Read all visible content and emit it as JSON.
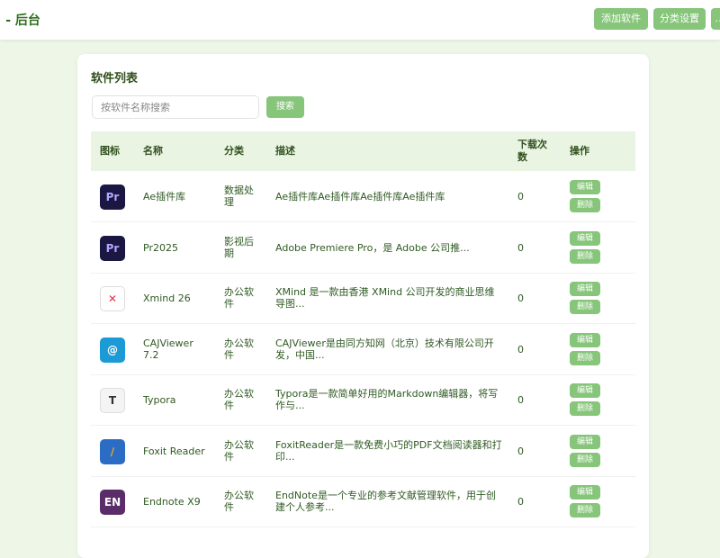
{
  "header": {
    "title": "· - 后台",
    "add_button": "添加软件",
    "category_button": "分类设置",
    "third_button": "…"
  },
  "card": {
    "title": "软件列表",
    "search_placeholder": "按软件名称搜索",
    "search_button": "搜索"
  },
  "table": {
    "headers": {
      "icon": "图标",
      "name": "名称",
      "category": "分类",
      "description": "描述",
      "downloads_line1": "下载次",
      "downloads_line2": "数",
      "actions": "操作"
    },
    "edit_label": "编辑",
    "delete_label": "删除",
    "rows": [
      {
        "icon": "premiere-icon",
        "icon_text": "Pr",
        "icon_bg": "#1a1742",
        "icon_fg": "#b4a7ff",
        "name1": "Ae插件库",
        "name2": "",
        "cat1": "数据处",
        "cat2": "理",
        "desc1": "Ae插件库Ae插件库Ae插件库Ae插件库",
        "desc2": "",
        "downloads": "0"
      },
      {
        "icon": "premiere-icon",
        "icon_text": "Pr",
        "icon_bg": "#1a1742",
        "icon_fg": "#b4a7ff",
        "name1": "Pr2025",
        "name2": "",
        "cat1": "影视后",
        "cat2": "期",
        "desc1": "Adobe Premiere Pro，是 Adobe 公司推...",
        "desc2": "",
        "downloads": "0"
      },
      {
        "icon": "xmind-icon",
        "icon_text": "✕",
        "icon_bg": "#ffffff",
        "icon_fg": "#e0324a",
        "name1": "Xmind 26",
        "name2": "",
        "cat1": "办公软",
        "cat2": "件",
        "desc1": "XMind 是一款由香港 XMind 公司开发的商业思维",
        "desc2": "导图...",
        "downloads": "0"
      },
      {
        "icon": "cajviewer-icon",
        "icon_text": "@",
        "icon_bg": "#1c9ad6",
        "icon_fg": "#ffffff",
        "name1": "CAJViewer",
        "name2": "7.2",
        "cat1": "办公软",
        "cat2": "件",
        "desc1": "CAJViewer是由同方知网（北京）技术有限公司开",
        "desc2": "发，中国...",
        "downloads": "0"
      },
      {
        "icon": "typora-icon",
        "icon_text": "T",
        "icon_bg": "#f4f4f4",
        "icon_fg": "#333333",
        "name1": "Typora",
        "name2": "",
        "cat1": "办公软",
        "cat2": "件",
        "desc1": "Typora是一款简单好用的Markdown编辑器，将写",
        "desc2": "作与...",
        "downloads": "0"
      },
      {
        "icon": "foxit-reader-icon",
        "icon_text": "∕",
        "icon_bg": "#2b6cc4",
        "icon_fg": "#f5a623",
        "name1": "Foxit Reader",
        "name2": "",
        "cat1": "办公软",
        "cat2": "件",
        "desc1": "FoxitReader是一款免费小巧的PDF文档阅读器和打",
        "desc2": "印...",
        "downloads": "0"
      },
      {
        "icon": "endnote-icon",
        "icon_text": "EN",
        "icon_bg": "#5a2d6a",
        "icon_fg": "#ffffff",
        "name1": "Endnote X9",
        "name2": "",
        "cat1": "办公软",
        "cat2": "件",
        "desc1": "EndNote是一个专业的参考文献管理软件，用于创",
        "desc2": "建个人参考...",
        "downloads": "0"
      }
    ]
  }
}
